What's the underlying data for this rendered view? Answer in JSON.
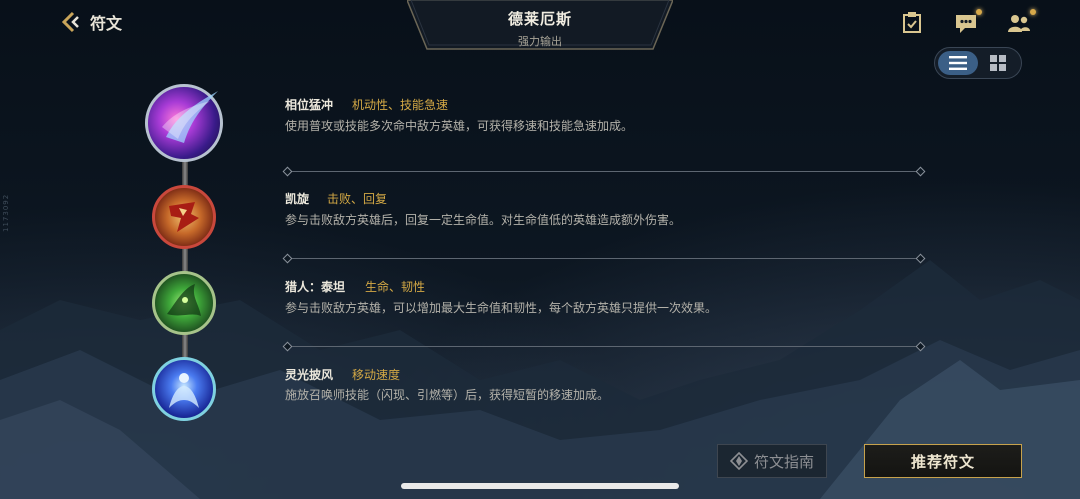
{
  "side_code": "1173092",
  "header": {
    "back_label": "符文",
    "hero_name": "德莱厄斯",
    "hero_role": "强力输出"
  },
  "toolbar": {
    "icons": [
      "task-icon",
      "chat-icon",
      "friends-icon"
    ],
    "view_modes": [
      "list",
      "grid"
    ],
    "active_view": "list"
  },
  "runes": [
    {
      "name": "相位猛冲",
      "tags": "机动性、技能急速",
      "desc": "使用普攻或技能多次命中敌方英雄，可获得移速和技能急速加成。"
    },
    {
      "name": "凯旋",
      "tags": "击败、回复",
      "desc": "参与击败敌方英雄后，回复一定生命值。对生命值低的英雄造成额外伤害。"
    },
    {
      "name": "猎人：泰坦",
      "tags": "生命、韧性",
      "desc": "参与击败敌方英雄，可以增加最大生命值和韧性，每个敌方英雄只提供一次效果。"
    },
    {
      "name": "灵光披风",
      "tags": "移动速度",
      "desc": "施放召唤师技能（闪现、引燃等）后，获得短暂的移速加成。"
    }
  ],
  "buttons": {
    "guide_label": "符文指南",
    "recommend_label": "推荐符文"
  },
  "colors": {
    "accent_gold": "#d3a845",
    "toggle_active": "#3b5f86"
  }
}
